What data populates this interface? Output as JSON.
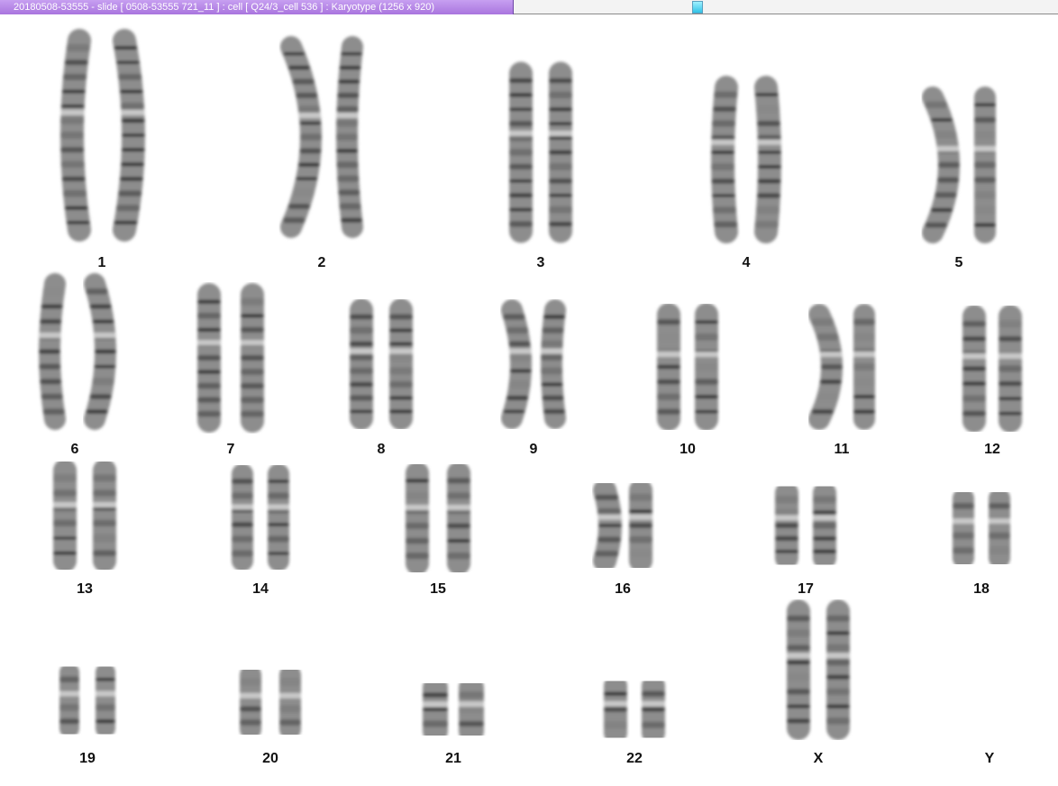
{
  "window": {
    "title": "20180508-53555 - slide [ 0508-53555 721_11 ] : cell [ Q24/3_cell 536 ] : Karyotype  (1256 x 920)"
  },
  "karyotype": {
    "chromosomes": [
      {
        "label": "1"
      },
      {
        "label": "2"
      },
      {
        "label": "3"
      },
      {
        "label": "4"
      },
      {
        "label": "5"
      },
      {
        "label": "6"
      },
      {
        "label": "7"
      },
      {
        "label": "8"
      },
      {
        "label": "9"
      },
      {
        "label": "10"
      },
      {
        "label": "11"
      },
      {
        "label": "12"
      },
      {
        "label": "13"
      },
      {
        "label": "14"
      },
      {
        "label": "15"
      },
      {
        "label": "16"
      },
      {
        "label": "17"
      },
      {
        "label": "18"
      },
      {
        "label": "19"
      },
      {
        "label": "20"
      },
      {
        "label": "21"
      },
      {
        "label": "22"
      },
      {
        "label": "X"
      },
      {
        "label": "Y"
      }
    ]
  }
}
